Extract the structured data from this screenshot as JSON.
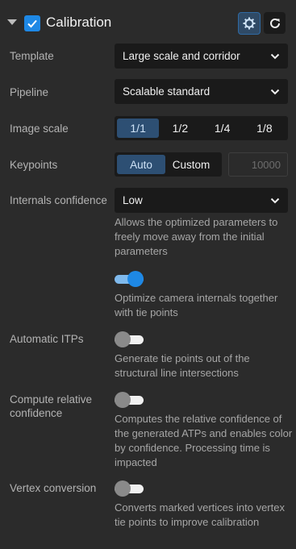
{
  "header": {
    "title": "Calibration",
    "checked": true
  },
  "template": {
    "label": "Template",
    "value": "Large scale and corridor"
  },
  "pipeline": {
    "label": "Pipeline",
    "value": "Scalable standard"
  },
  "image_scale": {
    "label": "Image scale",
    "options": [
      "1/1",
      "1/2",
      "1/4",
      "1/8"
    ],
    "selected": "1/1"
  },
  "keypoints": {
    "label": "Keypoints",
    "auto_label": "Auto",
    "custom_label": "Custom",
    "selected": "Auto",
    "placeholder": "10000"
  },
  "internals_confidence": {
    "label": "Internals confidence",
    "value": "Low",
    "help": "Allows the optimized parameters to freely move away from the initial parameters"
  },
  "optimize_internals": {
    "on": true,
    "help": "Optimize camera internals together with tie points"
  },
  "automatic_itps": {
    "label": "Automatic ITPs",
    "on": false,
    "help": "Generate tie points out of the structural line intersections"
  },
  "relative_confidence": {
    "label": "Compute relative confidence",
    "on": false,
    "help": "Computes the relative confidence of the generated ATPs and enables color by confidence. Processing time is impacted"
  },
  "vertex_conversion": {
    "label": "Vertex conversion",
    "on": false,
    "help": "Converts marked vertices into vertex tie points to improve calibration"
  },
  "colors": {
    "accent": "#1e88e5",
    "panel": "#2b2b2b",
    "field": "#1a1a1a",
    "selected_segment": "#2d4f73"
  }
}
